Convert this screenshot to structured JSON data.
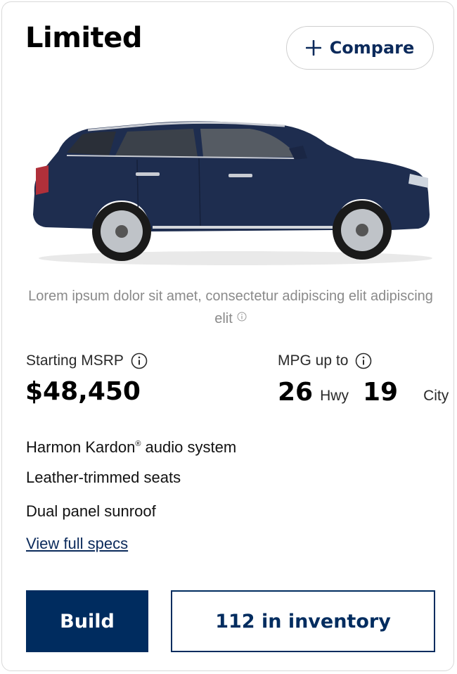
{
  "card": {
    "title": "Limited",
    "compare_label": "Compare",
    "image_alt": "Navy blue SUV side view",
    "disclaimer": "Lorem ipsum dolor sit amet, consectetur adipiscing elit adipiscing elit",
    "pricing": {
      "msrp_label": "Starting MSRP",
      "msrp_value": "$48,450"
    },
    "mpg": {
      "label": "MPG up to",
      "hwy_value": "26",
      "hwy_unit": "Hwy",
      "city_value": "19",
      "city_unit": "City"
    },
    "features": [
      {
        "text": "Harmon Kardon",
        "reg": "®",
        "suffix": " audio system"
      },
      {
        "text": "Leather-trimmed seats"
      },
      {
        "text": "Dual panel sunroof"
      }
    ],
    "specs_link": "View full specs",
    "build_label": "Build",
    "inventory_label": "112 in inventory"
  },
  "colors": {
    "brand_navy": "#002c5f",
    "car_body": "#1e2d4f",
    "disclaimer_gray": "#8a8a8a",
    "border": "#d9d9d9"
  },
  "icons": [
    "plus-icon",
    "info-icon"
  ]
}
